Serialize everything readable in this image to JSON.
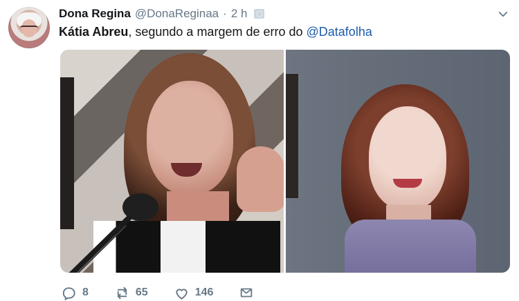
{
  "tweet": {
    "display_name": "Dona Regina",
    "handle": "@DonaReginaa",
    "separator": "·",
    "time": "2 h",
    "text_bold": "Kátia Abreu",
    "text_middle": ", segundo a margem de erro do ",
    "mention": "@Datafolha"
  },
  "actions": {
    "reply_count": "8",
    "retweet_count": "65",
    "like_count": "146"
  },
  "icons": {
    "chevron": "chevron-down-icon",
    "reply": "reply-icon",
    "retweet": "retweet-icon",
    "like": "heart-icon",
    "message": "mail-icon"
  },
  "colors": {
    "text": "#14171a",
    "secondary": "#657786",
    "mention": "#1b5cab"
  }
}
